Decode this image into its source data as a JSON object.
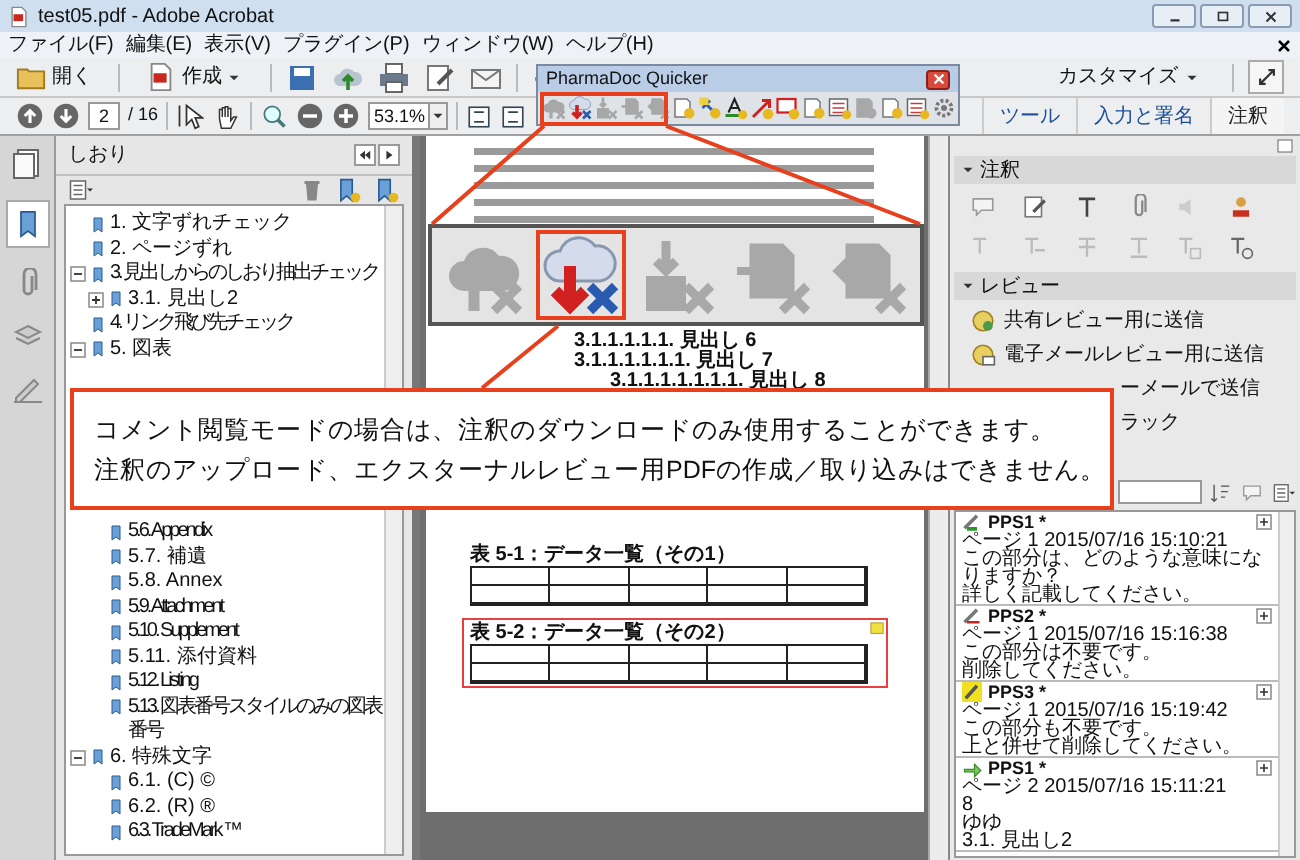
{
  "window": {
    "title": "test05.pdf - Adobe Acrobat"
  },
  "menu": [
    "ファイル(F)",
    "編集(E)",
    "表示(V)",
    "プラグイン(P)",
    "ウィンドウ(W)",
    "ヘルプ(H)"
  ],
  "toolbar": {
    "open_label": "開く",
    "create_label": "作成",
    "customize_label": "カスタマイズ"
  },
  "navigation": {
    "page": "2",
    "page_total": "/ 16",
    "zoom": "53.1%"
  },
  "right_tabs": [
    {
      "label": "ツール",
      "selected": false
    },
    {
      "label": "入力と署名",
      "selected": false
    },
    {
      "label": "注釈",
      "selected": true
    }
  ],
  "palette": {
    "title": "PharmaDoc Quicker",
    "tools": [
      {
        "kind": "cloud-up",
        "disabled": true
      },
      {
        "kind": "cloud-down",
        "disabled": false
      },
      {
        "kind": "box-down",
        "disabled": true
      },
      {
        "kind": "doc-out",
        "disabled": true
      },
      {
        "kind": "doc-in",
        "disabled": true
      },
      {
        "kind": "doc-badge",
        "disabled": false
      },
      {
        "kind": "link-badge",
        "disabled": false
      },
      {
        "kind": "text-badge",
        "disabled": false
      },
      {
        "kind": "arrow-badge",
        "disabled": false
      },
      {
        "kind": "frame-badge",
        "disabled": false
      },
      {
        "kind": "doc-badge",
        "disabled": false
      },
      {
        "kind": "list-badge",
        "disabled": false
      },
      {
        "kind": "doc-badge",
        "disabled": true
      },
      {
        "kind": "doc-badge",
        "disabled": false
      },
      {
        "kind": "list-badge",
        "disabled": false
      },
      {
        "kind": "gear",
        "disabled": false
      }
    ]
  },
  "magnified_tools": [
    {
      "kind": "cloud-up",
      "disabled": true,
      "highlighted": false
    },
    {
      "kind": "cloud-down",
      "disabled": false,
      "highlighted": true
    },
    {
      "kind": "box-down",
      "disabled": true,
      "highlighted": false
    },
    {
      "kind": "doc-out",
      "disabled": true,
      "highlighted": false
    },
    {
      "kind": "doc-in",
      "disabled": true,
      "highlighted": false
    }
  ],
  "bookmarks": {
    "title": "しおり",
    "items": [
      {
        "label": "1. 文字ずれチェック"
      },
      {
        "label": "2. ページずれ"
      },
      {
        "label": "3. 見出しからのしおり抽出チェック",
        "expanded": true,
        "children": [
          {
            "label": "3.1. 見出し2",
            "expanded": false
          }
        ]
      },
      {
        "label": "4. リンク飛び先チェック"
      },
      {
        "label": "5. 図表",
        "expanded": true,
        "children": [
          {
            "label": "5.6. Appendix"
          },
          {
            "label": "5.7. 補遺"
          },
          {
            "label": "5.8. Annex"
          },
          {
            "label": "5.9. Attachment"
          },
          {
            "label": "5.10. Supplement"
          },
          {
            "label": "5.11. 添付資料"
          },
          {
            "label": "5.12. Listing"
          },
          {
            "label": "5.13. 図表番号スタイルのみの図表番号"
          }
        ]
      },
      {
        "label": "6. 特殊文字",
        "expanded": true,
        "children": [
          {
            "label": "6.1. (C) ©"
          },
          {
            "label": "6.2. (R) ®"
          },
          {
            "label": "6.3. TradeMark ™"
          }
        ]
      }
    ]
  },
  "document": {
    "headings": [
      {
        "label": "3.1.1.1.1.1. 見出し 6"
      },
      {
        "label": "3.1.1.1.1.1.1. 見出し 7",
        "children": [
          {
            "label": "3.1.1.1.1.1.1.1. 見出し 8"
          }
        ]
      }
    ],
    "tables": [
      {
        "caption": "表 5-1：データ一覧（その1）",
        "highlighted": false
      },
      {
        "caption": "表 5-2：データ一覧（その2）",
        "highlighted": true
      }
    ]
  },
  "callout": {
    "lines": [
      "コメント閲覧モードの場合は、注釈のダウンロードのみ使用することができます。",
      "注釈のアップロード、エクスターナルレビュー用PDFの作成／取り込みはできません。"
    ]
  },
  "comment_panel": {
    "annotation_section": "注釈",
    "review_section": "レビュー",
    "review_items": [
      {
        "label": "共有レビュー用に送信",
        "kind": "shared"
      },
      {
        "label": "電子メールレビュー用に送信",
        "kind": "email"
      },
      {
        "label": "ーメールで送信",
        "kind": "partial"
      },
      {
        "label": "ラック",
        "kind": "partial"
      }
    ],
    "comments": [
      {
        "author": "PPS1 *",
        "kind": "note",
        "meta": "ページ 1 2015/07/16 15:10:21",
        "lines": [
          "この部分は、どのような意味になりますか？",
          "詳しく記載してください。"
        ]
      },
      {
        "author": "PPS2 *",
        "kind": "strike",
        "meta": "ページ 1 2015/07/16 15:16:38",
        "lines": [
          "この部分は不要です。",
          "削除してください。"
        ]
      },
      {
        "author": "PPS3 *",
        "kind": "highlight",
        "meta": "ページ 1 2015/07/16 15:19:42",
        "lines": [
          "この部分も不要です。",
          "上と併せて削除してください。"
        ]
      },
      {
        "author": "PPS1 *",
        "kind": "insert",
        "meta": "ページ 2 2015/07/16 15:11:21",
        "lines": [
          "8",
          "ゆゆ",
          "3.1. 見出し2"
        ]
      }
    ]
  }
}
